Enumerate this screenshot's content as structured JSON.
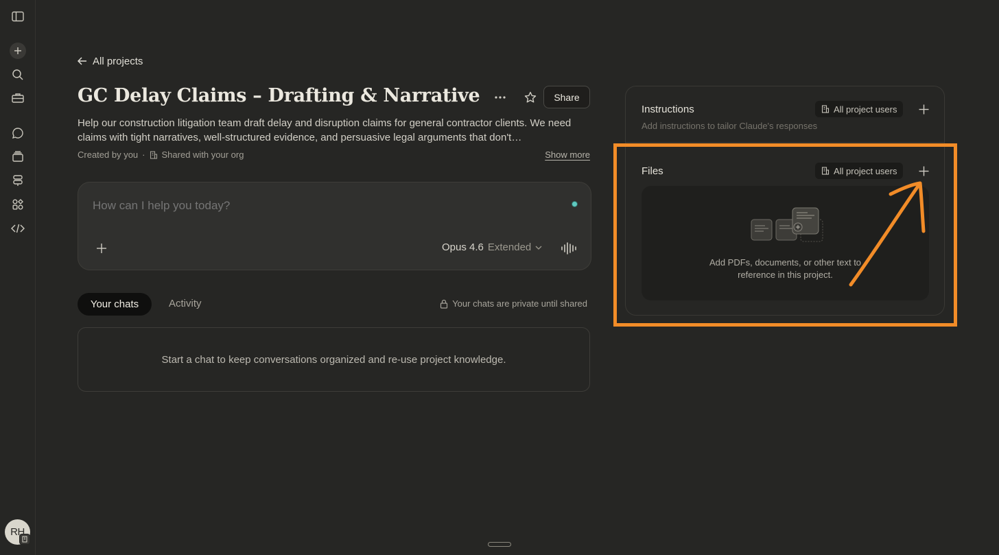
{
  "sidebar": {
    "avatar_initials": "RH",
    "icons": [
      "sidebar-toggle-icon",
      "new-chat-icon",
      "search-icon",
      "toolbox-icon",
      "chats-icon",
      "projects-icon",
      "signpost-icon",
      "apps-icon",
      "code-icon"
    ]
  },
  "back_link": "All projects",
  "project": {
    "title": "GC Delay Claims – Drafting & Narrative",
    "share_label": "Share",
    "description": "Help our construction litigation team draft delay and disruption claims for general contractor clients. We need claims with tight narratives, well-structured evidence, and persuasive legal arguments that don't…",
    "created_by": "Created by you",
    "shared_with": "Shared with your org",
    "show_more": "Show more"
  },
  "composer": {
    "placeholder": "How can I help you today?",
    "model": "Opus 4.6",
    "mode": "Extended"
  },
  "tabs": {
    "active": "Your chats",
    "other": "Activity",
    "private_note": "Your chats are private until shared"
  },
  "chats_empty": "Start a chat to keep conversations organized and re-use project knowledge.",
  "instructions": {
    "title": "Instructions",
    "users": "All project users",
    "subtitle": "Add instructions to tailor Claude's responses"
  },
  "files": {
    "title": "Files",
    "users": "All project users",
    "empty_line1": "Add PDFs, documents, or other text to",
    "empty_line2": "reference in this project."
  },
  "colors": {
    "background": "#262624",
    "highlight": "#f28c28",
    "status_dot": "#5fc9c0"
  }
}
